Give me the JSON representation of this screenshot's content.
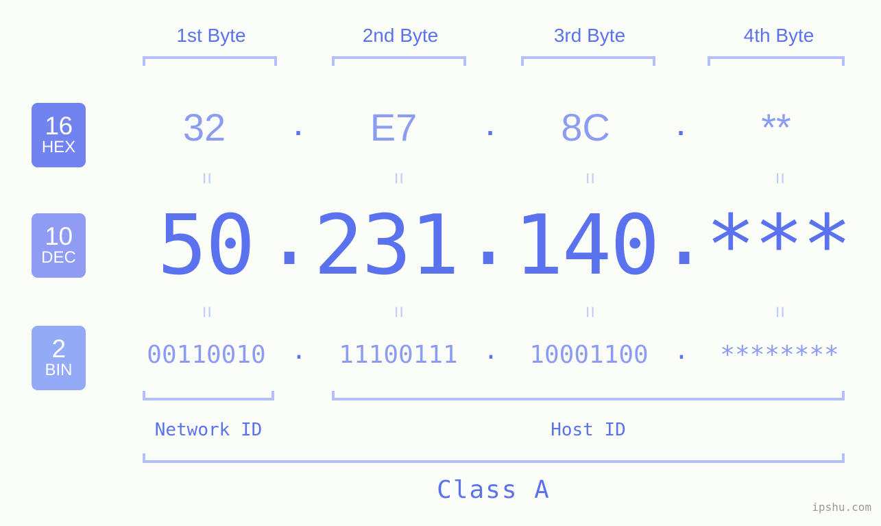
{
  "watermark": "ipshu.com",
  "separator": ".",
  "equals_glyph": "=",
  "byte_headers": [
    {
      "label": "1st Byte"
    },
    {
      "label": "2nd Byte"
    },
    {
      "label": "3rd Byte"
    },
    {
      "label": "4th Byte"
    }
  ],
  "bases": [
    {
      "number": "16",
      "name": "HEX",
      "color": "#7183ef"
    },
    {
      "number": "10",
      "name": "DEC",
      "color": "#8e9cf4"
    },
    {
      "number": "2",
      "name": "BIN",
      "color": "#93aaf7"
    }
  ],
  "rows": {
    "hex": {
      "base_number": "16",
      "base_name": "HEX",
      "values": [
        "32",
        "E7",
        "8C",
        "**"
      ]
    },
    "dec": {
      "base_number": "10",
      "base_name": "DEC",
      "values": [
        "50",
        "231",
        "140",
        "***"
      ]
    },
    "bin": {
      "base_number": "2",
      "base_name": "BIN",
      "values": [
        "00110010",
        "11100111",
        "10001100",
        "********"
      ]
    }
  },
  "segments": {
    "network_id": "Network ID",
    "host_id": "Host ID",
    "class": "Class A"
  },
  "colors": {
    "background": "#fbfdf8",
    "accent_strong": "#5b72ee",
    "accent_mid": "#8c9cf2",
    "accent_light": "#b4c0fb",
    "equals": "#c2ccfa",
    "watermark": "#9a9a9a"
  }
}
